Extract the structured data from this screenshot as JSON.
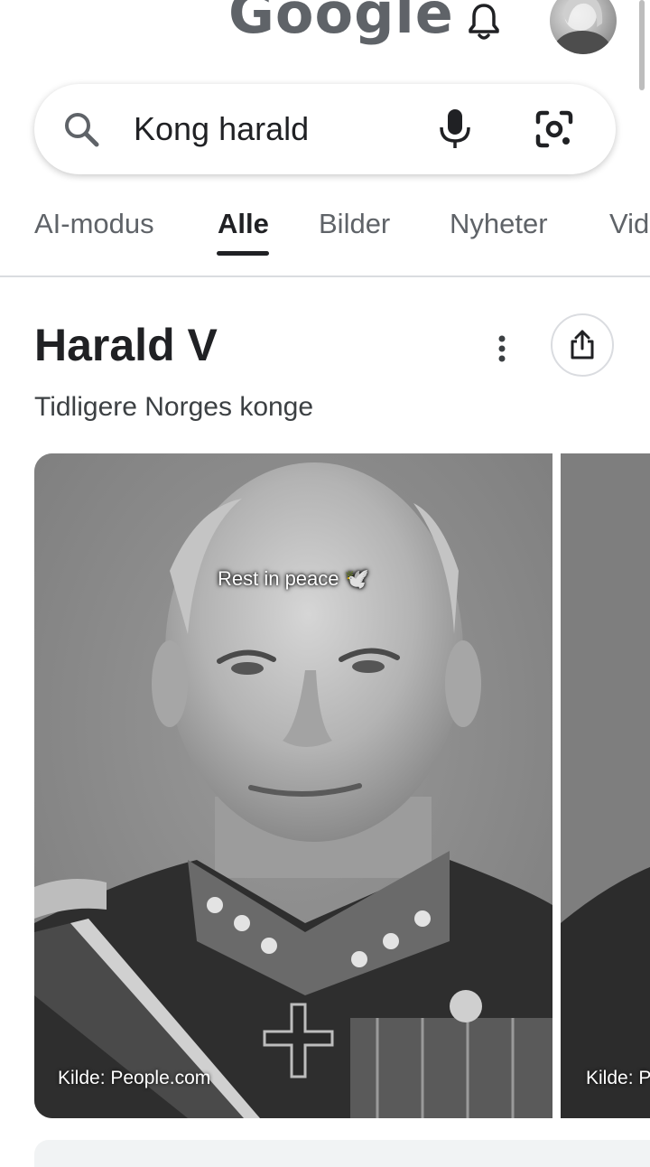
{
  "header": {
    "logo_text": "Google",
    "bell_icon": "bell-icon",
    "avatar": "user-avatar"
  },
  "search": {
    "query": "Kong harald",
    "search_icon": "search-icon",
    "mic_icon": "mic-icon",
    "lens_icon": "google-lens-icon"
  },
  "tabs": [
    {
      "label": "AI-modus",
      "active": false
    },
    {
      "label": "Alle",
      "active": true
    },
    {
      "label": "Bilder",
      "active": false
    },
    {
      "label": "Nyheter",
      "active": false
    },
    {
      "label": "Vid",
      "active": false
    }
  ],
  "knowledge_panel": {
    "title": "Harald V",
    "subtitle": "Tidligere Norges konge",
    "more_icon": "more-vert-icon",
    "share_icon": "share-icon"
  },
  "images": [
    {
      "overlay_text": "Rest in peace 🕊️",
      "source": "Kilde: People.com"
    },
    {
      "source": "Kilde: P"
    }
  ],
  "colors": {
    "text_primary": "#202124",
    "text_secondary": "#5f6368",
    "divider": "#dadce0"
  }
}
